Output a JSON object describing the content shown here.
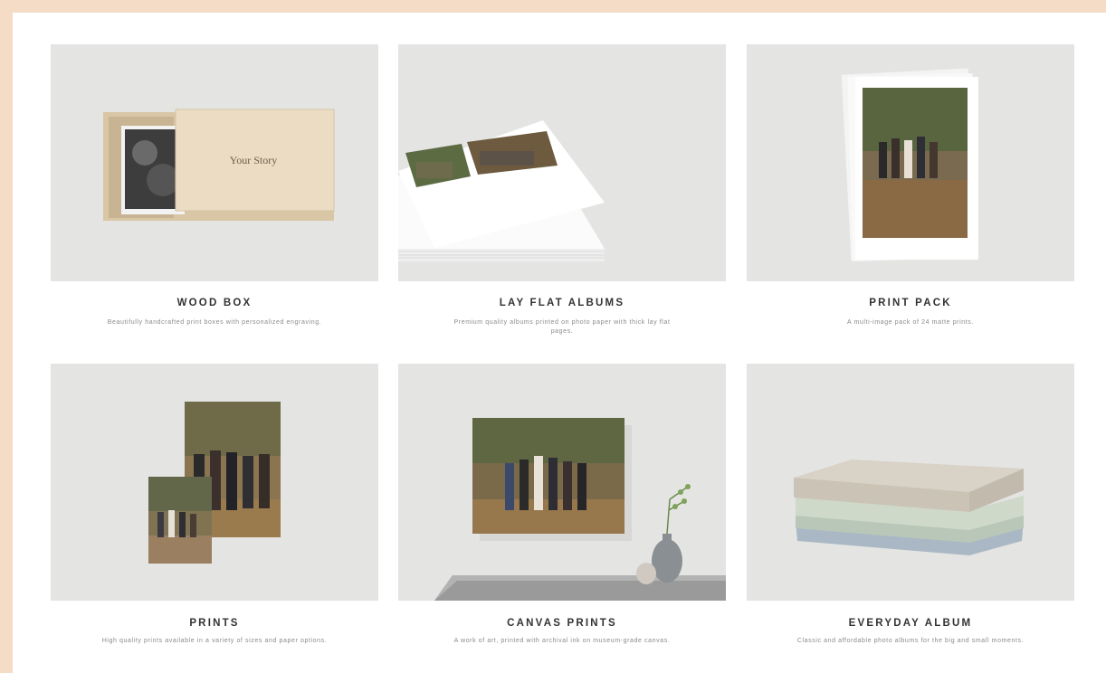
{
  "products": [
    {
      "title": "WOOD BOX",
      "description": "Beautifully handcrafted print boxes with personalized engraving.",
      "engraving_text": "Your Story"
    },
    {
      "title": "LAY FLAT ALBUMS",
      "description": "Premium quality albums printed on photo paper with thick lay flat pages."
    },
    {
      "title": "PRINT PACK",
      "description": "A multi-image pack of 24 matte prints."
    },
    {
      "title": "PRINTS",
      "description": "High quality prints available in a variety of sizes and paper options."
    },
    {
      "title": "CANVAS PRINTS",
      "description": "A work of art, printed with archival ink on museum-grade canvas."
    },
    {
      "title": "EVERYDAY ALBUM",
      "description": "Classic and affordable photo albums for the big and small moments."
    }
  ],
  "colors": {
    "page_border": "#f5dcc7",
    "card_background": "#e4e4e3",
    "title_text": "#333333",
    "description_text": "#8a8a8a"
  }
}
